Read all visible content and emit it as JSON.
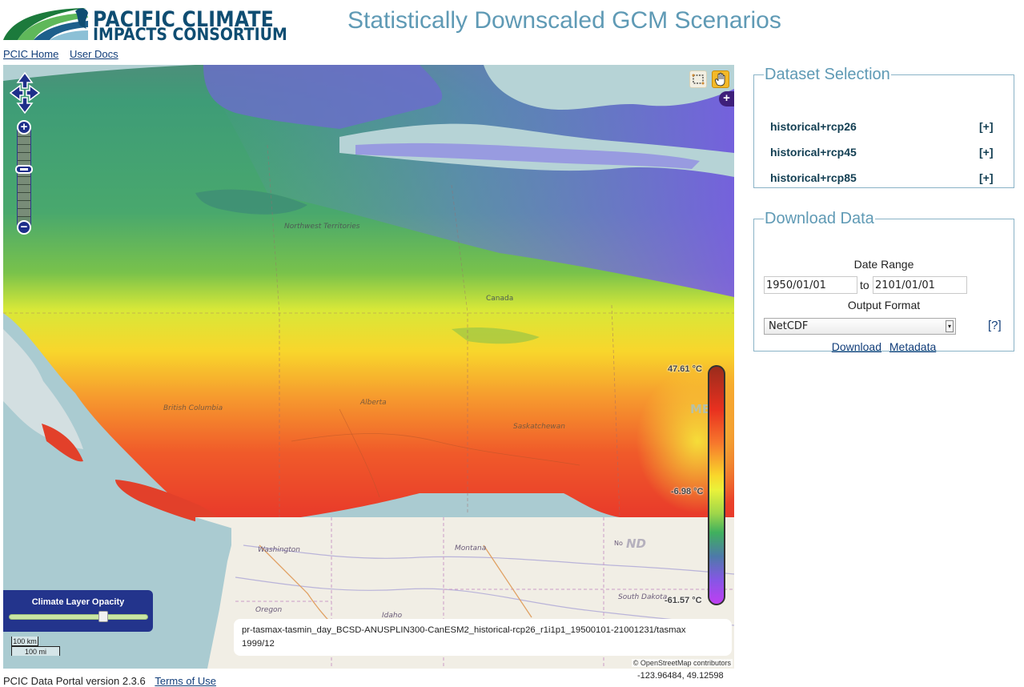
{
  "header": {
    "logo_line1": "PACIFIC CLIMATE",
    "logo_line2": "IMPACTS CONSORTIUM",
    "title": "Statistically Downscaled GCM Scenarios"
  },
  "nav": {
    "home": "PCIC Home",
    "docs": "User Docs"
  },
  "map": {
    "labels": {
      "nwt": "Northwest Territories",
      "canada": "Canada",
      "bc": "British Columbia",
      "alberta": "Alberta",
      "sask": "Saskatchewan",
      "mb": "MB",
      "washington": "Washington",
      "montana": "Montana",
      "nd": "ND",
      "nd_prefix": "No",
      "oregon": "Oregon",
      "idaho": "Idaho",
      "south_dakota": "South Dakota"
    },
    "legend": {
      "max": "47.61 °C",
      "mid": "-6.98 °C",
      "min": "-61.57 °C"
    },
    "opacity": {
      "title": "Climate Layer Opacity",
      "value": 0.68
    },
    "scale": {
      "km": "100 km",
      "mi": "100 mi"
    },
    "layer_info": {
      "name": "pr-tasmax-tasmin_day_BCSD-ANUSPLIN300-CanESM2_historical-rcp26_r1i1p1_19500101-21001231/tasmax",
      "time": "1999/12"
    },
    "attribution": "© OpenStreetMap contributors",
    "coords": "-123.96484, 49.12598",
    "zoom_in": "+",
    "zoom_out": "−",
    "layer_switcher": "+"
  },
  "footer": {
    "version": "PCIC Data Portal version 2.3.6",
    "terms": "Terms of Use"
  },
  "dataset_selection": {
    "title": "Dataset Selection",
    "items": [
      {
        "label": "historical+rcp26",
        "toggle": "[+]"
      },
      {
        "label": "historical+rcp45",
        "toggle": "[+]"
      },
      {
        "label": "historical+rcp85",
        "toggle": "[+]"
      }
    ]
  },
  "download": {
    "title": "Download Data",
    "date_range_label": "Date Range",
    "start_date": "1950/01/01",
    "to_label": "to",
    "end_date": "2101/01/01",
    "format_label": "Output Format",
    "format_value": "NetCDF",
    "help": "[?]",
    "download_link": "Download",
    "metadata_link": "Metadata"
  }
}
